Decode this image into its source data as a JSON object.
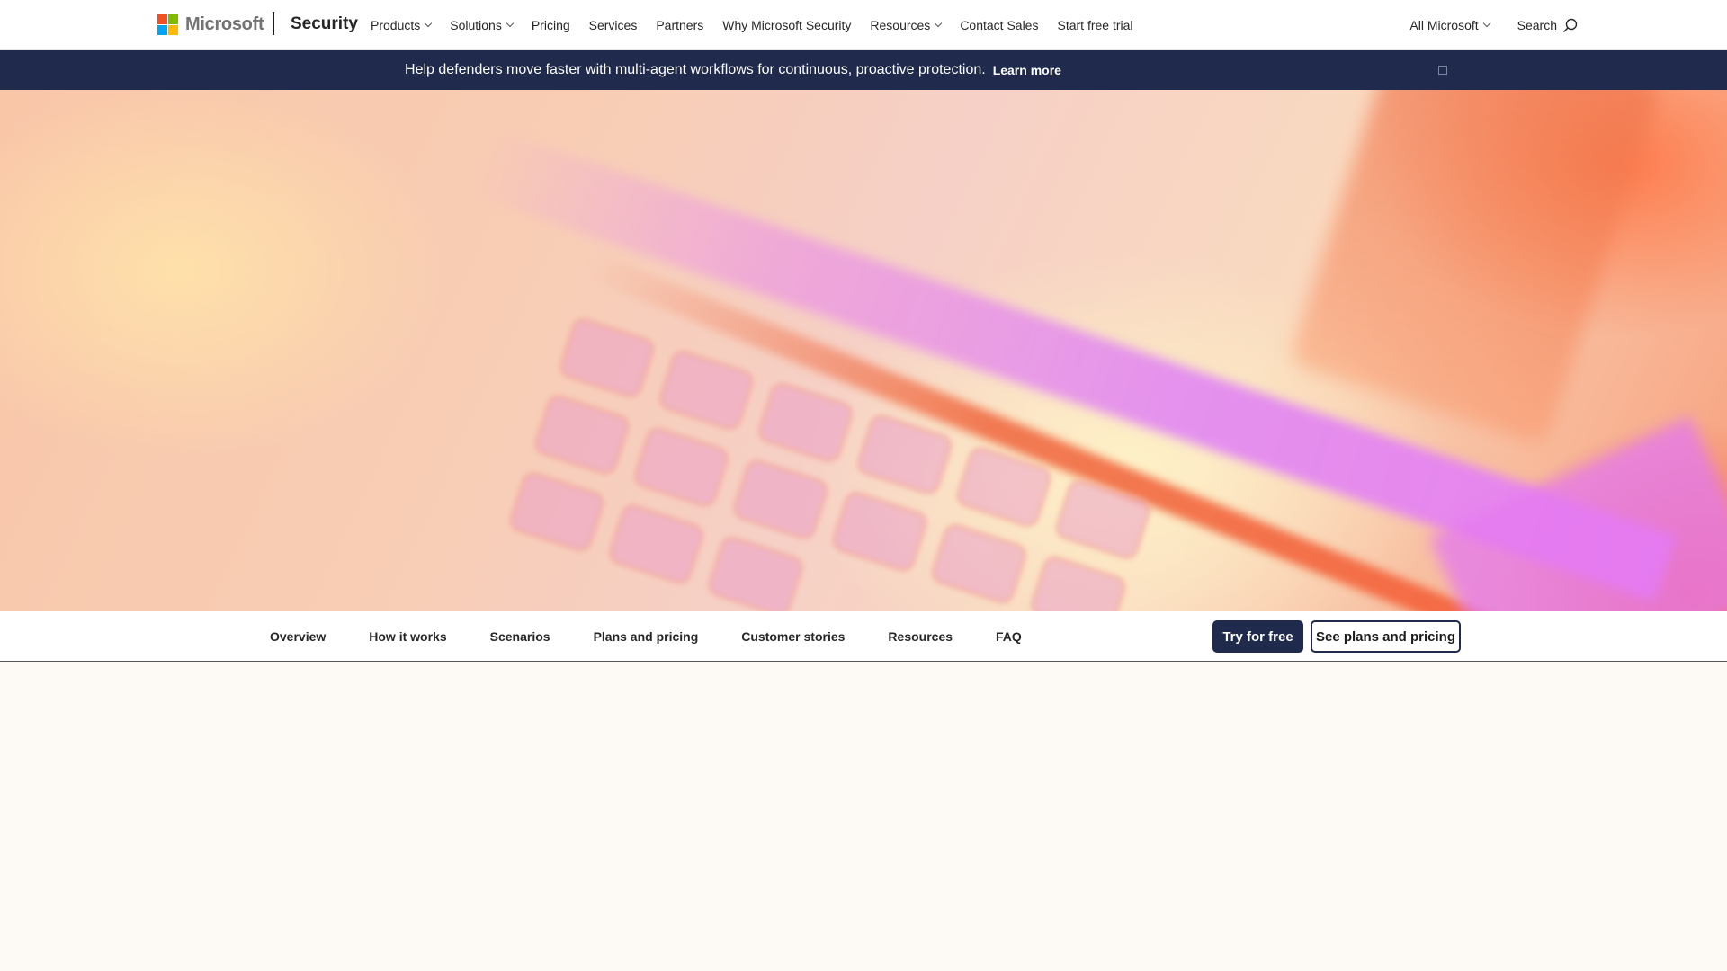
{
  "header": {
    "brand": "Microsoft",
    "logo_colors": [
      "#f25022",
      "#7fba00",
      "#00a4ef",
      "#ffb900"
    ],
    "product": "Security",
    "nav": [
      {
        "label": "Products",
        "dropdown": true
      },
      {
        "label": "Solutions",
        "dropdown": true
      },
      {
        "label": "Pricing",
        "dropdown": false
      },
      {
        "label": "Services",
        "dropdown": false
      },
      {
        "label": "Partners",
        "dropdown": false
      },
      {
        "label": "Why Microsoft Security",
        "dropdown": false
      },
      {
        "label": "Resources",
        "dropdown": true
      },
      {
        "label": "Contact Sales",
        "dropdown": false
      },
      {
        "label": "Start free trial",
        "dropdown": false
      }
    ],
    "all_microsoft": "All Microsoft",
    "search_label": "Search"
  },
  "banner": {
    "text": "Help defenders move faster with multi-agent workflows for continuous, proactive protection.",
    "link": "Learn more",
    "background": "#1f2a4d"
  },
  "subnav": {
    "tabs": [
      "Overview",
      "How it works",
      "Scenarios",
      "Plans and pricing",
      "Customer stories",
      "Resources",
      "FAQ"
    ],
    "primary_button": "Try for free",
    "secondary_button": "See plans and pricing"
  }
}
